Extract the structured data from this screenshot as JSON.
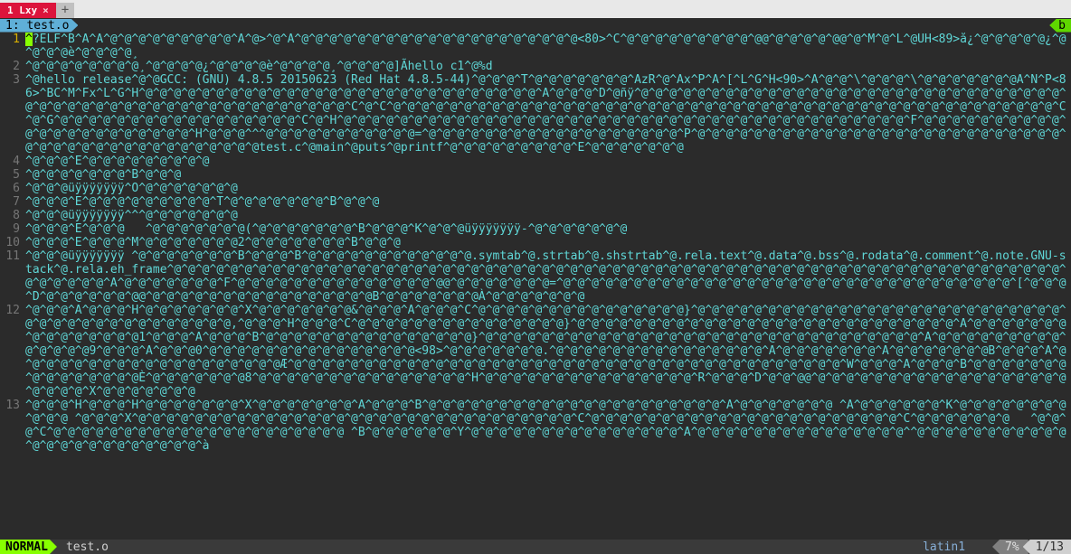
{
  "window": {
    "tab_label": "1 Lxy",
    "tab_close": "×",
    "tab_add": "+"
  },
  "buffer": {
    "label_left": "1: test.o",
    "label_right": "b"
  },
  "content": {
    "cursor_char": "^",
    "lines": [
      {
        "n": "1",
        "text_after_cursor": "?ELF^B^A^A^@^@^@^@^@^@^@^@^@^A^@>^@^A^@^@^@^@^@^@^@^@^@^@^@^@^@^@^@^@^@^@^@^@<80>^C^@^@^@^@^@^@^@^@^@^@@^@^@^@^@^@@^@^M^@^L^@UH<89>å¿^@^@^@^@^@¿^@^@^@^@è^@^@^@^@¸"
      },
      {
        "n": "2",
        "text": "^@^@^@^@^@^@^@^@¸^@^@^@^@¿^@^@^@^@è^@^@^@^@¸^@^@^@^@]Ãhello c1^@%d"
      },
      {
        "n": "3",
        "text": "^@hello release^@^@GCC: (GNU) 4.8.5 20150623 (Red Hat 4.8.5-44)^@^@^@^T^@^@^@^@^@^@^@^AzR^@^Ax^P^A^[^L^G^H<90>^A^@^@^\\^@^@^@^\\^@^@^@^@^@^@^@A^N^P<86>^BC^M^Fx^L^G^H^@^@^@^@^@^@^@^@^@^@^@^@^@^@^@^@^@^@^@^@^@^@^@^@^@^@^@^@^A^@^@^@^D^@ñÿ^@^@^@^@^@^@^@^@^@^@^@^@^@^@^@^@^@^@^@^@^@^@^@^@^@^@^@^@^@^@^@^@^@^@^@^@^@^@^@^@^@^@^@^@^@^@^@^@^@^@^@^@^@^C^@^C^@^@^@^@^@^@^@^@^@^@^@^@^@^@^@^@^@^@^@^@^@^@^@^@^@^@^@^@^@^@^@^@^@^@^@^@^@^@^@^@^@^@^@^@^@^@^@^C^@^G^@^@^@^@^@^@^@^@^@^@^@^@^@^@^@^@^@^C^@^H^@^@^@^@^@^@^@^@^@^@^@^@^@^@^@^@^@^@^@^@^@^@^@^@^@^@^@^@^@^@^@^@^@^@^@^@^@^@^@^@^F^@^@^@^@^@^@^@^@^@^@^@^@^@^@^@^@^@^@^@^@^@^@^H^@^@^@^^^@^@^@^@^@^@^@^@^@^@^@=^@^@^@^@^@^@^@^@^@^@^@^@^@^@^@^@^@^@^P^@^@^@^@^@^@^@^@^@^@^@^@^@^@^@^@^@^@^@^@^@^@^@^@^@^@^@^@^@^@^@^@^@^@^@^@^@^@^@^@^@^@^@test.c^@main^@puts^@printf^@^@^@^@^@^@^@^@^@^E^@^@^@^@^@^@^@"
      },
      {
        "n": "4",
        "text": "^@^@^@^E^@^@^@^@^@^@^@^@^@"
      },
      {
        "n": "5",
        "text": "^@^@^@^@^@^@^@^B^@^@^@"
      },
      {
        "n": "6",
        "text": "^@^@^@üÿÿÿÿÿÿÿ^O^@^@^@^@^@^@^@"
      },
      {
        "n": "7",
        "text": "^@^@^@^E^@^@^@^@^@^@^@^@^@^T^@^@^@^@^@^@^@^B^@^@^@"
      },
      {
        "n": "8",
        "text": "^@^@^@üÿÿÿÿÿÿÿ^^^@^@^@^@^@^@^@"
      },
      {
        "n": "9",
        "text": "^@^@^@^E^@^@^@   ^@^@^@^@^@^@^@(^@^@^@^@^@^@^@^B^@^@^@^K^@^@^@üÿÿÿÿÿÿÿ-^@^@^@^@^@^@^@"
      },
      {
        "n": "10",
        "text": "^@^@^@^E^@^@^@^M^@^@^@^@^@^@^@2^@^@^@^@^@^@^@^B^@^@^@"
      },
      {
        "n": "11",
        "text": "^@^@^@üÿÿÿÿÿÿÿ ^@^@^@^@^@^@^@^B^@^@^@^B^@^@^@^@^@^@^@^@^@^@^@^@.symtab^@.strtab^@.shstrtab^@.rela.text^@.data^@.bss^@.rodata^@.comment^@.note.GNU-stack^@.rela.eh_frame^@^@^@^@^@^@^@^@^@^@^@^@^@^@^@^@^@^@^@^@^@^@^@^@^@^@^@^@^@^@^@^@^@^@^@^@^@^@^@^@^@^@^@^@^@^@^@^@^@^@^@^@^@^@^@^@^@^@^@^@^@^@^@^@^@^@^@^@^@^A^@^@^@^@^@^@^@^F^@^@^@^@^@^@^@^@^@^@^@^@^@^@^@@^@^@^@^@^@^@^@=^@^@^@^@^@^@^@^@^@^@^@^@^@^@^@^@^@^@^@^@^@^@^@^@^@^@^@^@^@^@^@^@^[^@^@^@^D^@^@^@^@^@^@^@@^@^@^@^@^@^@^@^@^@^@^@^@^@^@^@^@B^@^@^@^@^@^@^@À^@^@^@^@^@^@^@"
      },
      {
        "n": "12",
        "text": "^@^@^@^A^@^@^@^H^@^@^@^@^@^@^@^X^@^@^@^@^@^@^@&^@^@^@^A^@^@^@^C^@^@^@^@^@^@^@^@^@^@^@^@^@^@^@}^@^@^@^@^@^@^@^@^@^@^@^@^@^@^@^@^@^@^@^@^@^@^@^@^@^@^@^@^@^@^@^@^@^@^@^@^@^@^@^@^@,^@^@^@^H^@^@^@^C^@^@^@^@^@^@^@^@^@^@^@^@^@^@^@}^@^@^@^@^@^@^@^@^@^@^@^@^@^@^@^@^@^@^@^@^@^@^@^@^@^@^@^A^@^@^@^@^@^@^@^@^@^@^@^@^@^@^@1^@^@^@^A^@^@^@^B^@^@^@^@^@^@^@^@^@^@^@^@^@^@^@}^@^@^@^@^@^@^@^@^@^@^@^@^@^@^@^@^@^@^@^@^@^@^@^@^@^@^@^@^@^@^@^A^@^@^@^@^@^@^@^@^@^@^@^@^@^@9^@^@^@^A^@^@^@0^@^@^@^@^@^@^@^@^@^@^@^@^@^@^@<98>^@^@^@^@^@^@^@.^@^@^@^@^@^@^@^@^@^@^@^@^@^@^@^A^@^@^@^@^@^@^@^A^@^@^@^@^@^@^@B^@^@^@^A^@^@^@^@^@^@^@^@^@^@^@^@^@^@^@^@^@^@^@Æ^@^@^@^@^@^@^@^@^@^@^@^@^@^@^@^@^@^@^@^@^@^@^@^@^@^@^@^@^@^@^@^@^@^@^@^@^@^@^@^W^@^@^@^A^@^@^@^B^@^@^@^@^@^@^@^@^@^@^@^@^@^@^@È^@^@^@^@^@^@^@8^@^@^@^@^@^@^@^@^@^@^@^@^@^@^@^H^@^@^@^@^@^@^@^@^@^@^@^@^@^@^@^R^@^@^@^D^@^@^@@^@^@^@^@^@^@^@^@^@^@^@^@^@^@^@^@^@^@^@^@^@^@^X^@^@^@^@^@^@^@"
      },
      {
        "n": "13",
        "text": "^@^@^@^H^@^@^@^H^@^@^@^@^@^@^@^X^@^@^@^@^@^@^@^A^@^@^@^B^@^@^@^@^@^@^@^@^@^@^@^@^@^@^@^@^@^@^@^@^@^A^@^@^@^@^@^@^@ ^A^@^@^@^@^@^@^K^@^@^@^@^@^@^@^@^@^@^@ ^@^@^@^X^@^@^@^@^@^@^@^@^@^@^@^@^@^@^@^@^@^@^@^@^@^@^@^@^@^@^@^@^@^@^@^C^@^@^@^@^@^@^@^@^@^@^@^@^@^@^@^@^@^@^@^@^@^@^C^@^@^@^@^@^@^@   ^@^@^@^C^@^@^@^@^@^@^@^@^@^@^@^@^@^@^@^@^@^@^@^@^@ ^B^@^@^@^@^@^@^Y^@^@^@^@^@^@^@^@^@^@^@^@^@^@^@^A^@^@^@^@^@^@^@^@^@^@^@^@^@^@^@^^@^@^@^@^@^@^@^@^@^@^@^@^@^@^@^@^@^@^@^@^@^@^@^à"
      }
    ]
  },
  "status": {
    "mode": "NORMAL",
    "filename": "test.o",
    "encoding": "latin1",
    "percent": "7%",
    "position": "1/13"
  }
}
